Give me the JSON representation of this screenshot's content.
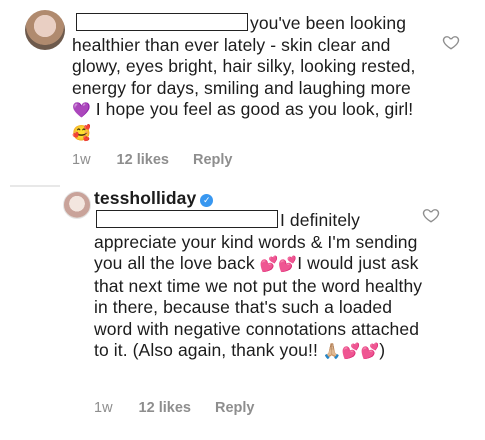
{
  "comments": [
    {
      "text_before": "you've been looking healthier than ever lately - skin clear and glowy, eyes bright, hair silky, looking rested, energy for days, smiling and laughing more ",
      "emoji_1": "💜",
      "text_after": " I hope you feel as good as you look, girl! ",
      "emoji_2": "🥰",
      "time_ago": "1w",
      "likes": "12 likes",
      "reply_label": "Reply"
    },
    {
      "username": "tessholliday",
      "verified": true,
      "text_before": "I definitely appreciate your kind words & I'm sending you all the love back ",
      "emoji_1": "💕💕",
      "text_middle": "I would just ask that next time we not put the word healthy in there, because that's such a loaded word with negative connotations attached to it. (Also again, thank you!! ",
      "emoji_2": "🙏🏼💕💕",
      "text_end": ")",
      "time_ago": "1w",
      "likes": "12 likes",
      "reply_label": "Reply"
    }
  ],
  "icons": {
    "like": "heart-outline-icon",
    "verified": "verified-badge-icon"
  },
  "colors": {
    "meta": "#8e8e8e",
    "verified": "#3897f0",
    "text": "#1c1c1c"
  }
}
